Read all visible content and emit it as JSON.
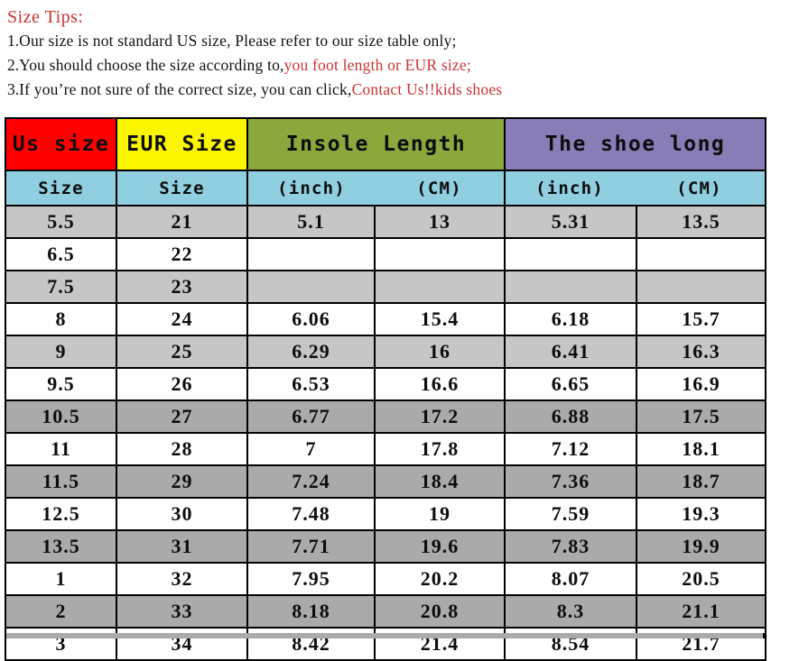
{
  "tips": {
    "title": "Size Tips:",
    "lines": [
      {
        "num": "1.",
        "black": "Our size is not standard US size, Please refer to our size table only;",
        "red": ""
      },
      {
        "num": "2.",
        "black": "You should choose the size according to,",
        "red": "you foot length or EUR size;"
      },
      {
        "num": "3.",
        "black": "If you’re not sure of the correct size, you can click,",
        "red": "Contact Us!!kids shoes"
      }
    ]
  },
  "colors": {
    "us_header_bg": "#FE0000",
    "eur_header_bg": "#FCF500",
    "insole_header_bg": "#8BA83D",
    "shoe_header_bg": "#8A7CB6",
    "subheader_bg": "#90CFE0",
    "row_light_gray": "#C6C6C6",
    "row_dark_gray": "#AAAAAA",
    "row_white": "#FFFFFF",
    "tips_red": "#CC3333",
    "border": "#000000"
  },
  "table": {
    "group_headers": [
      {
        "label": "Us size",
        "span": 1
      },
      {
        "label": "EUR Size",
        "span": 1
      },
      {
        "label": "Insole Length",
        "span": 2
      },
      {
        "label": "The shoe long",
        "span": 2
      }
    ],
    "sub_headers": [
      "Size",
      "Size",
      "(inch)",
      "(CM)",
      "(inch)",
      "(CM)"
    ],
    "rows": [
      {
        "shade": "light",
        "cells": [
          "5.5",
          "21",
          "5.1",
          "13",
          "5.31",
          "13.5"
        ]
      },
      {
        "shade": "white",
        "cells": [
          "6.5",
          "22",
          "",
          "",
          "",
          ""
        ]
      },
      {
        "shade": "light",
        "cells": [
          "7.5",
          "23",
          "",
          "",
          "",
          ""
        ]
      },
      {
        "shade": "white",
        "cells": [
          "8",
          "24",
          "6.06",
          "15.4",
          "6.18",
          "15.7"
        ]
      },
      {
        "shade": "light",
        "cells": [
          "9",
          "25",
          "6.29",
          "16",
          "6.41",
          "16.3"
        ]
      },
      {
        "shade": "white",
        "cells": [
          "9.5",
          "26",
          "6.53",
          "16.6",
          "6.65",
          "16.9"
        ]
      },
      {
        "shade": "dark",
        "cells": [
          "10.5",
          "27",
          "6.77",
          "17.2",
          "6.88",
          "17.5"
        ]
      },
      {
        "shade": "white",
        "cells": [
          "11",
          "28",
          "7",
          "17.8",
          "7.12",
          "18.1"
        ]
      },
      {
        "shade": "dark",
        "cells": [
          "11.5",
          "29",
          "7.24",
          "18.4",
          "7.36",
          "18.7"
        ]
      },
      {
        "shade": "white",
        "cells": [
          "12.5",
          "30",
          "7.48",
          "19",
          "7.59",
          "19.3"
        ]
      },
      {
        "shade": "dark",
        "cells": [
          "13.5",
          "31",
          "7.71",
          "19.6",
          "7.83",
          "19.9"
        ]
      },
      {
        "shade": "white",
        "cells": [
          "1",
          "32",
          "7.95",
          "20.2",
          "8.07",
          "20.5"
        ]
      },
      {
        "shade": "dark",
        "cells": [
          "2",
          "33",
          "8.18",
          "20.8",
          "8.3",
          "21.1"
        ]
      },
      {
        "shade": "white",
        "cells": [
          "3",
          "34",
          "8.42",
          "21.4",
          "8.54",
          "21.7"
        ]
      }
    ]
  }
}
